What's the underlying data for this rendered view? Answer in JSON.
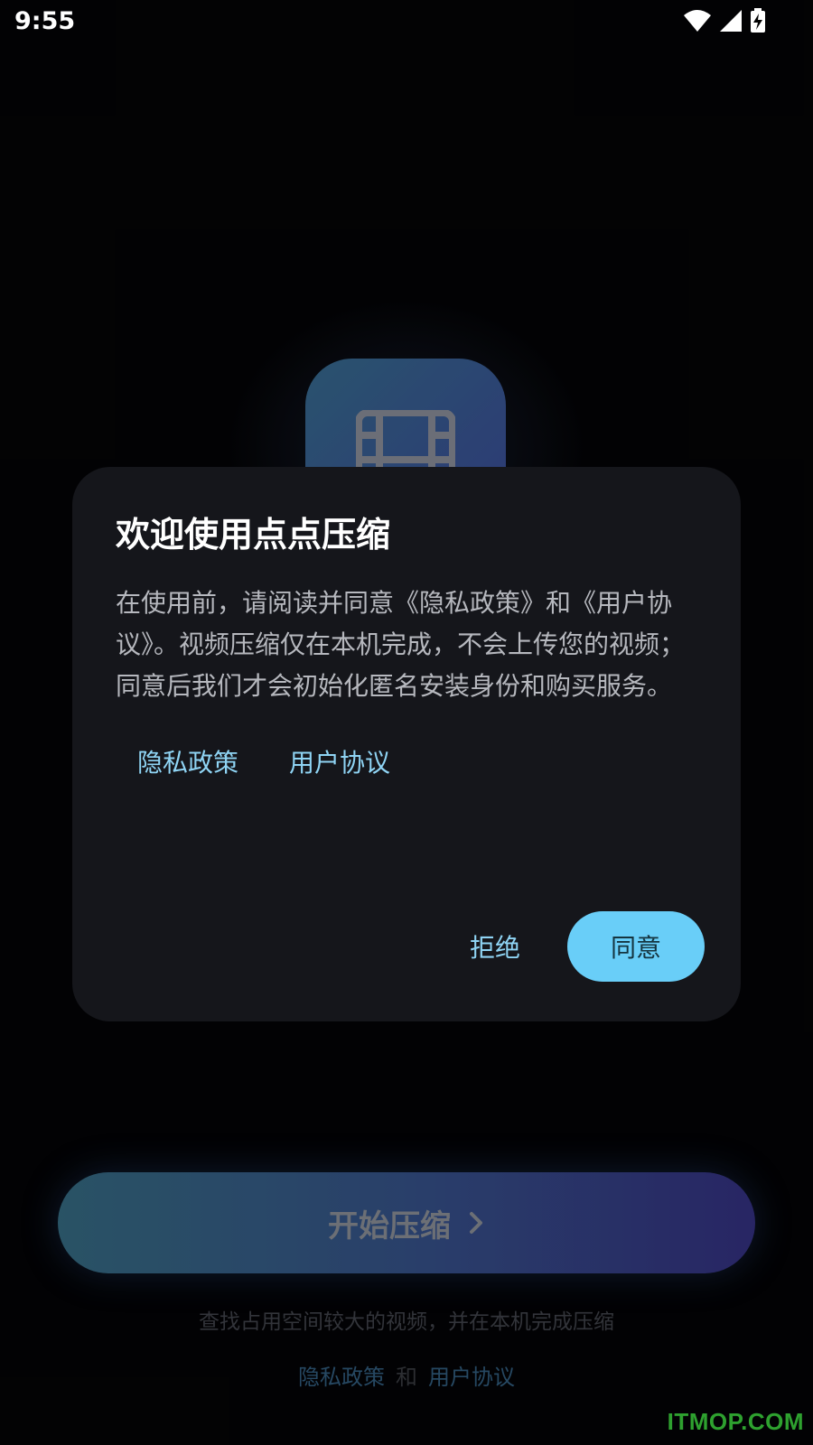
{
  "status_bar": {
    "time": "9:55"
  },
  "app": {
    "icon": "film-icon",
    "start_button_label": "开始压缩",
    "subtitle": "查找占用空间较大的视频，并在本机完成压缩",
    "footer": {
      "privacy_link": "隐私政策",
      "and": "和",
      "terms_link": "用户协议"
    }
  },
  "dialog": {
    "title": "欢迎使用点点压缩",
    "body": "在使用前，请阅读并同意《隐私政策》和《用户协议》。视频压缩仅在本机完成，不会上传您的视频；同意后我们才会初始化匿名安装身份和购买服务。",
    "privacy_link": "隐私政策",
    "terms_link": "用户协议",
    "reject_label": "拒绝",
    "agree_label": "同意"
  },
  "watermark": "ITMOP.COM",
  "colors": {
    "accent": "#69cef8",
    "link": "#8fd4f4",
    "dialog_bg": "#15161b",
    "watermark": "#2ea12f"
  }
}
